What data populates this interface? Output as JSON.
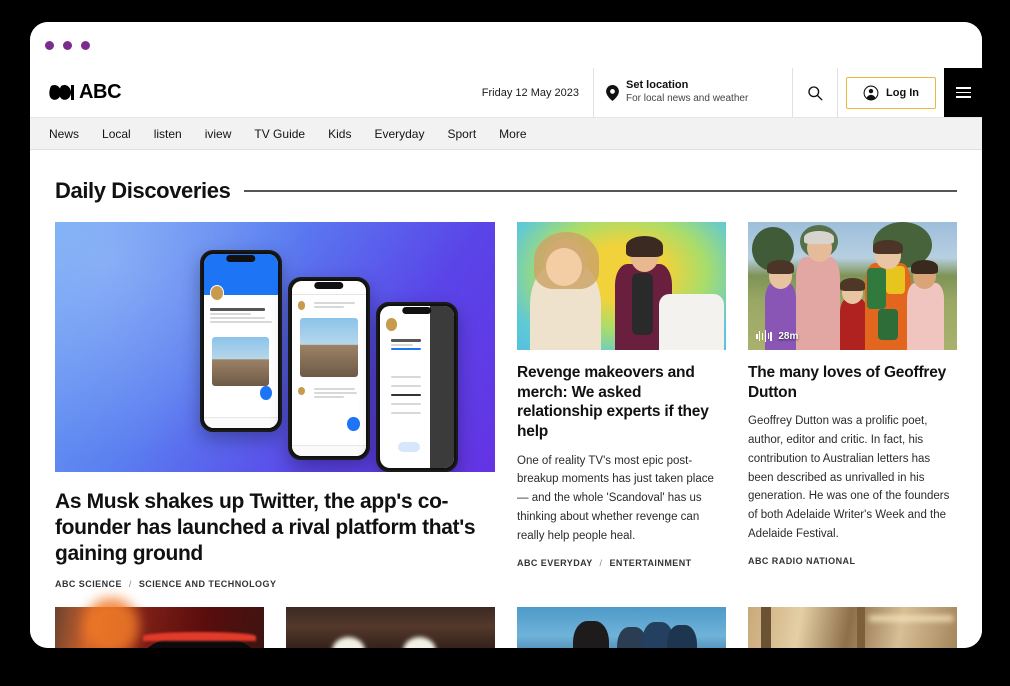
{
  "window": {
    "dots": [
      "dot-1",
      "dot-2",
      "dot-3"
    ],
    "dot_color": "#7B2D8E"
  },
  "masthead": {
    "brand": "ABC",
    "date": "Friday 12 May 2023",
    "location": {
      "title": "Set location",
      "subtitle": "For local news and weather",
      "icon": "map-pin-icon"
    },
    "search_icon": "search-icon",
    "login_label": "Log In",
    "login_icon": "user-circle-icon",
    "login_border_color": "#E8B93B",
    "menu_icon": "hamburger-menu-icon"
  },
  "subnav": {
    "items": [
      {
        "label": "News"
      },
      {
        "label": "Local"
      },
      {
        "label": "listen"
      },
      {
        "label": "iview"
      },
      {
        "label": "TV Guide"
      },
      {
        "label": "Kids"
      },
      {
        "label": "Everyday"
      },
      {
        "label": "Sport"
      },
      {
        "label": "More"
      }
    ]
  },
  "section": {
    "title": "Daily Discoveries"
  },
  "articles": {
    "hero": {
      "headline": "As Musk shakes up Twitter, the app's co-founder has launched a rival platform that's gaining ground",
      "brand": "ABC SCIENCE",
      "separator": "/",
      "topic": "SCIENCE AND TECHNOLOGY",
      "image_alt": "Three smartphones showing a social media app interface on a blue gradient background"
    },
    "middle": {
      "headline": "Revenge makeovers and merch: We asked relationship experts if they help",
      "standfirst": "One of reality TV's most epic post-breakup moments has just taken place — and the whole 'Scandoval' has us thinking about whether revenge can really help people heal.",
      "brand": "ABC EVERYDAY",
      "separator": "/",
      "topic": "ENTERTAINMENT",
      "image_alt": "A laughing blonde woman and a man in a maroon jacket on a yellow and green background"
    },
    "right": {
      "headline": "The many loves of Geoffrey Dutton",
      "standfirst": "Geoffrey Dutton was a prolific poet, author, editor and critic. In fact, his contribution to Australian letters has been described as unrivalled in his generation. He was one of the founders of both Adelaide Writer's Week and the Adelaide Festival.",
      "brand": "ABC RADIO NATIONAL",
      "duration": "28m",
      "duration_icon": "audio-waveform-icon",
      "image_alt": "A vintage family photograph of adults and children standing on a lawn"
    }
  },
  "bottom_row": {
    "items": [
      {
        "image_alt": "Blurred red car at night"
      },
      {
        "image_alt": "Dark tunnel interior with lights"
      },
      {
        "image_alt": "Group of people against a blue sky"
      },
      {
        "image_alt": "Warm lit interior corridor"
      }
    ]
  }
}
